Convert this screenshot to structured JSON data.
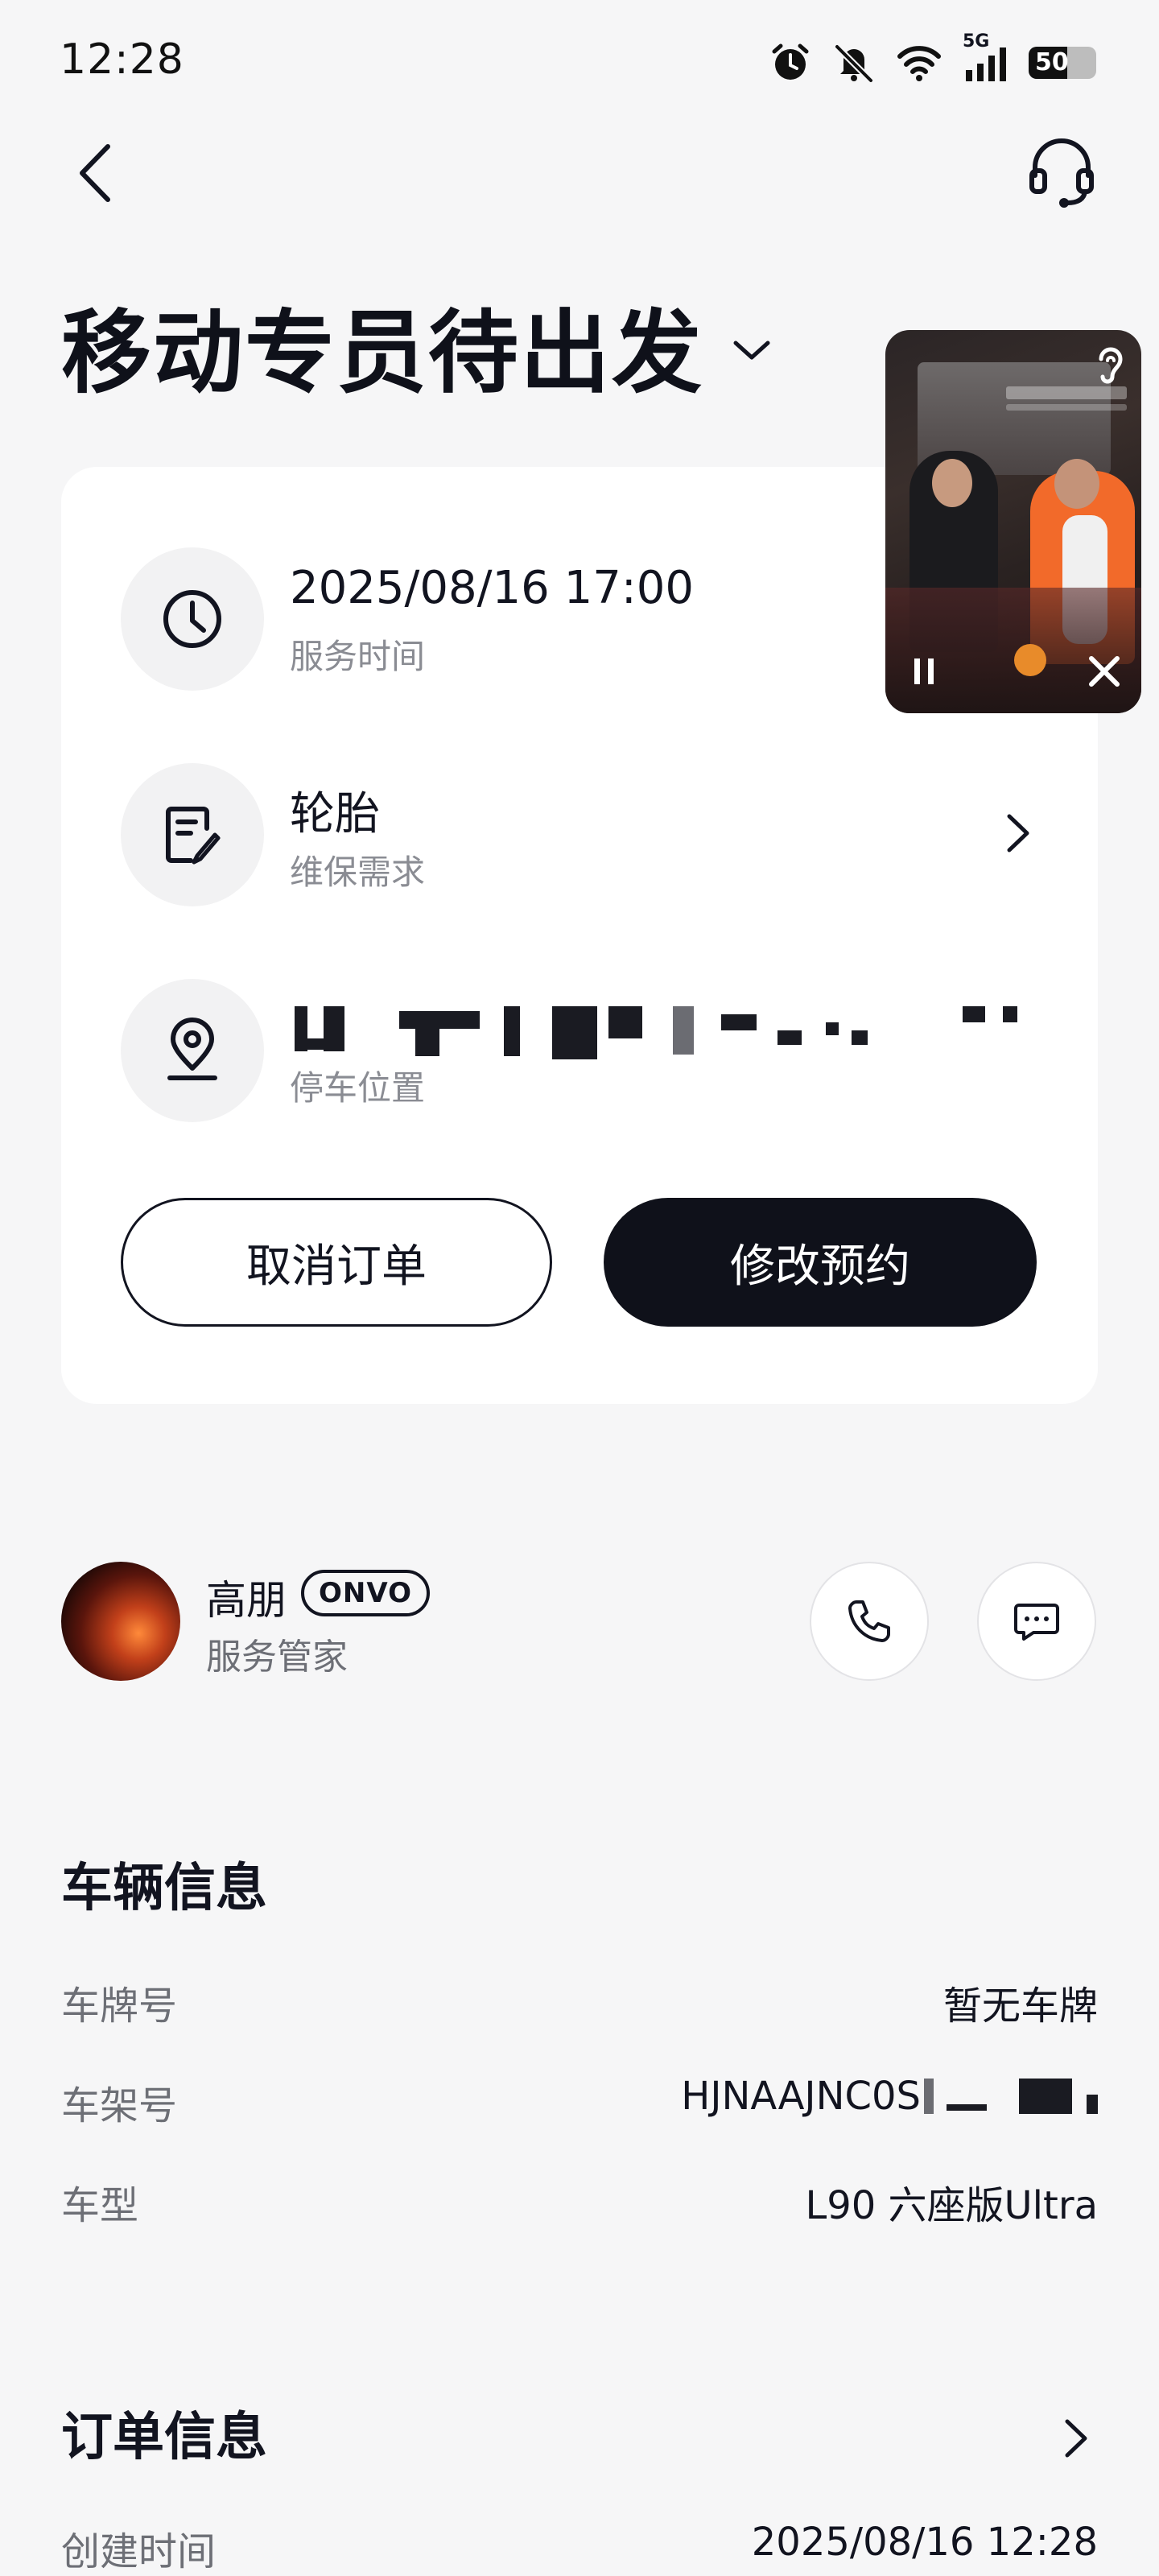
{
  "status_bar": {
    "time": "12:28",
    "network": "5G",
    "battery": "50",
    "icons": [
      "alarm-icon",
      "mute-icon",
      "wifi-icon",
      "signal-icon",
      "battery-icon"
    ]
  },
  "header": {
    "title": "移动专员待出发",
    "back_icon": "back-arrow-icon",
    "support_icon": "headset-icon"
  },
  "service_card": {
    "time_row": {
      "value": "2025/08/16 17:00",
      "label": "服务时间",
      "icon": "clock-icon"
    },
    "demand_row": {
      "value": "轮胎",
      "label": "维保需求",
      "icon": "edit-note-icon"
    },
    "location_row": {
      "value": "",
      "label": "停车位置",
      "icon": "location-pin-icon"
    },
    "cancel_label": "取消订单",
    "modify_label": "修改预约"
  },
  "manager": {
    "name": "高朋",
    "brand_badge": "ONVO",
    "role": "服务管家"
  },
  "vehicle_info": {
    "title": "车辆信息",
    "rows": [
      {
        "label": "车牌号",
        "value": "暂无车牌"
      },
      {
        "label": "车架号",
        "value": "HJNAAJNC0S"
      },
      {
        "label": "车型",
        "value": "L90 六座版Ultra"
      }
    ]
  },
  "order_info": {
    "title": "订单信息",
    "rows": [
      {
        "label": "创建时间",
        "value": "2025/08/16 12:28"
      }
    ]
  }
}
